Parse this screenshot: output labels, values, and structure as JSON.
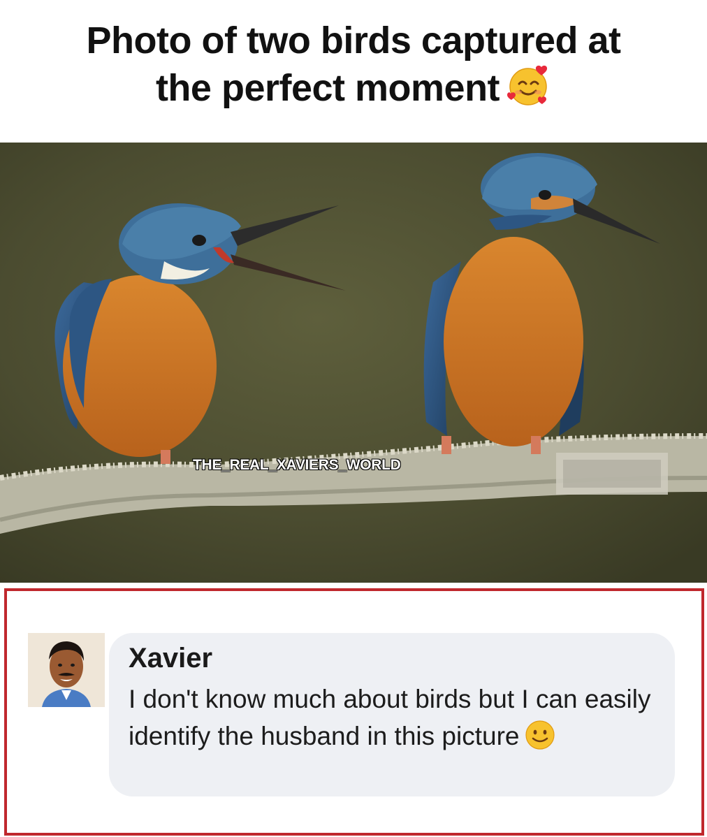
{
  "headline": {
    "line1": "Photo of two birds captured at",
    "line2": "the perfect moment",
    "emoji_icon": "smiling-face-with-hearts-icon"
  },
  "photo": {
    "watermark": "THE_REAL_XAVIERS_WORLD"
  },
  "comment": {
    "author": "Xavier",
    "text": "I don't know much about birds but I can easily identify the husband in this picture",
    "emoji_icon": "slightly-smiling-face-icon",
    "border_color": "#c0282d",
    "bubble_color": "#eef0f4"
  }
}
